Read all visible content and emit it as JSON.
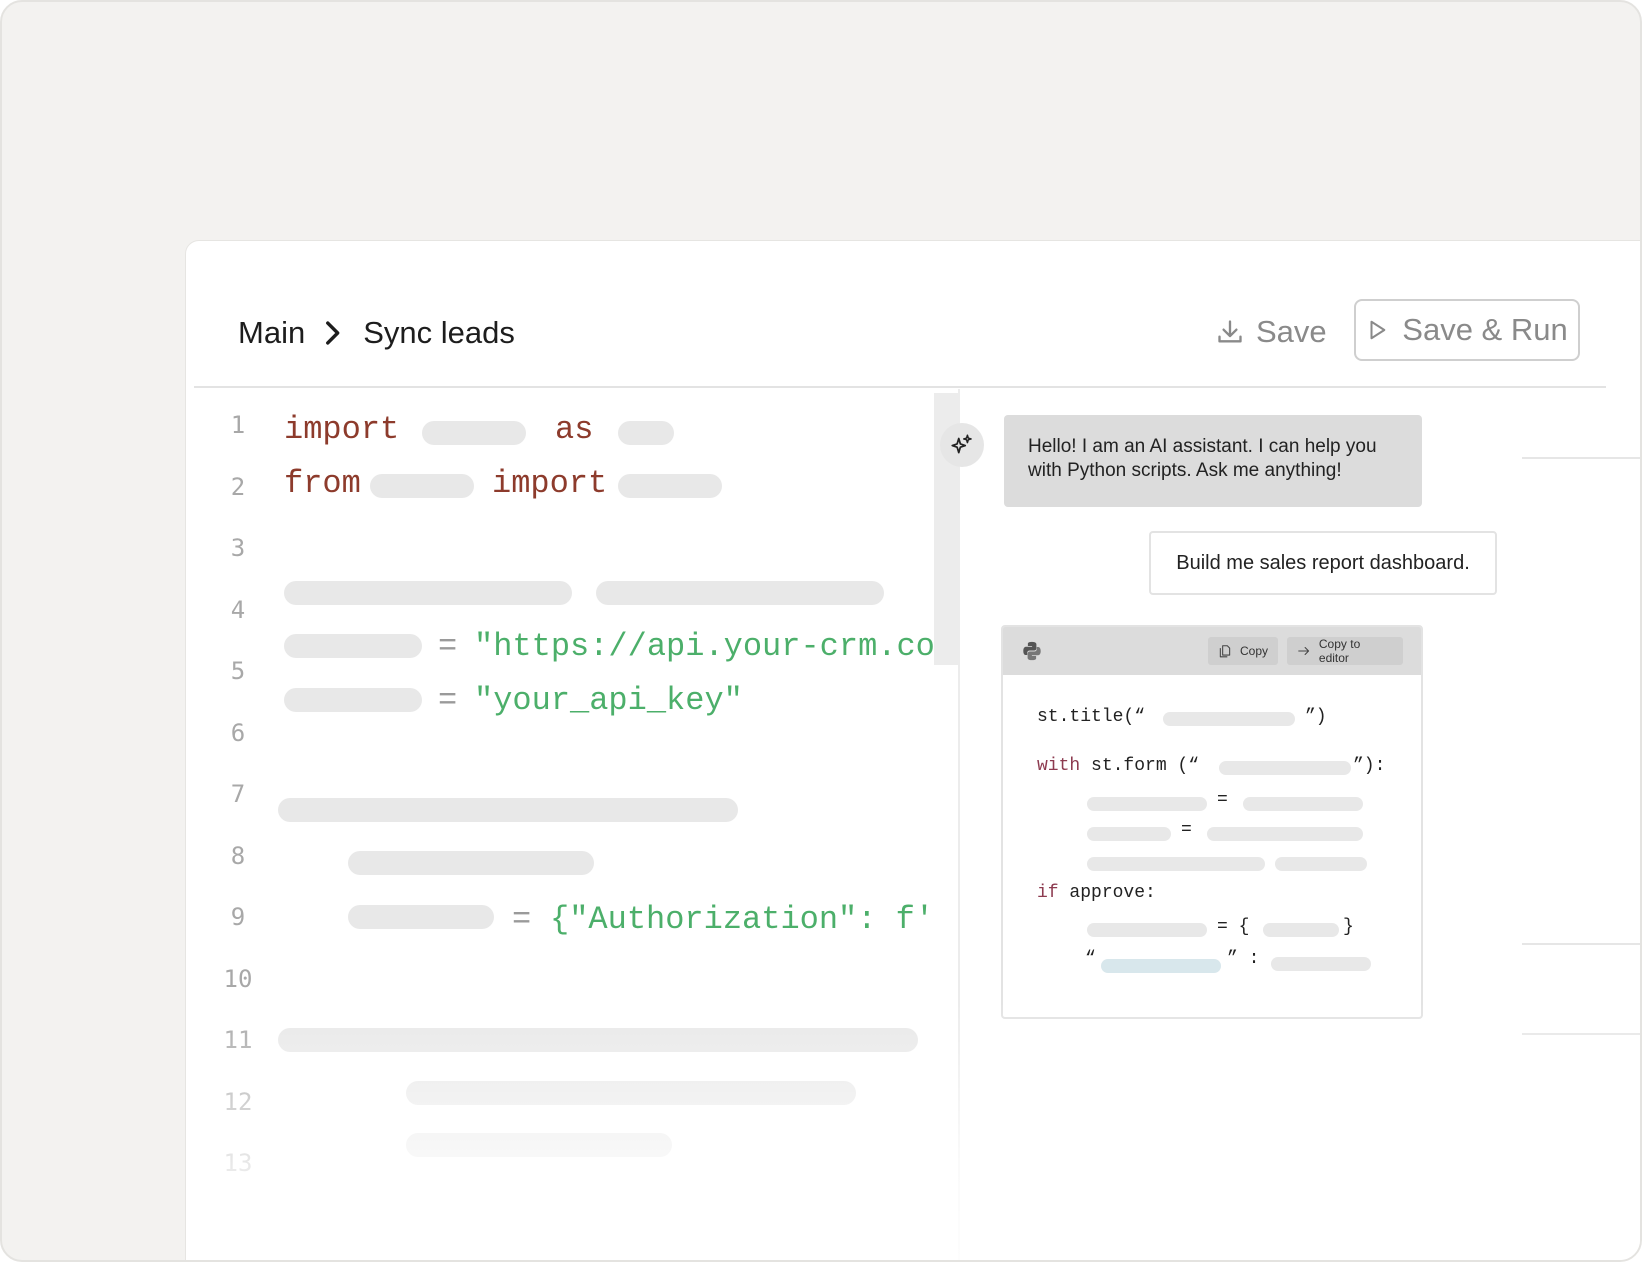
{
  "breadcrumb": {
    "root": "Main",
    "current": "Sync leads"
  },
  "toolbar": {
    "save_label": "Save",
    "save_run_label": "Save & Run"
  },
  "editor": {
    "line_numbers": [
      "1",
      "2",
      "3",
      "4",
      "5",
      "6",
      "7",
      "8",
      "9",
      "10",
      "11",
      "12",
      "13"
    ],
    "line1": {
      "kw1": "import",
      "kw2": "as"
    },
    "line2": {
      "kw1": "from",
      "kw2": "import"
    },
    "line5": {
      "op": "=",
      "str": "\"https://api.your-crm.co"
    },
    "line6": {
      "op": "=",
      "str": "\"your_api_key\""
    },
    "line9": {
      "op": "=",
      "str": "{\"Authorization\": f'"
    }
  },
  "chat": {
    "assistant_message": "Hello! I am an AI assistant. I can help you with Python scripts. Ask me anything!",
    "user_message": "Build me sales report dashboard.",
    "code_card": {
      "copy_label": "Copy",
      "copy_to_editor_label": "Copy to editor",
      "l1_a": "st.title(“",
      "l1_b": "”)",
      "l2_kw": "with",
      "l2_a": " st.form (“",
      "l2_b": "”):",
      "eq": "=",
      "l6_kw": "if",
      "l6_a": " approve:",
      "l7_eq": "= {",
      "l7_close": "}",
      "l8_q1": "“",
      "l8_q2": "” :"
    }
  },
  "colors": {
    "keyword": "#8d3b2c",
    "string": "#4caf6a",
    "placeholder": "#e8e8e8",
    "bubble": "#dcdcdc"
  }
}
